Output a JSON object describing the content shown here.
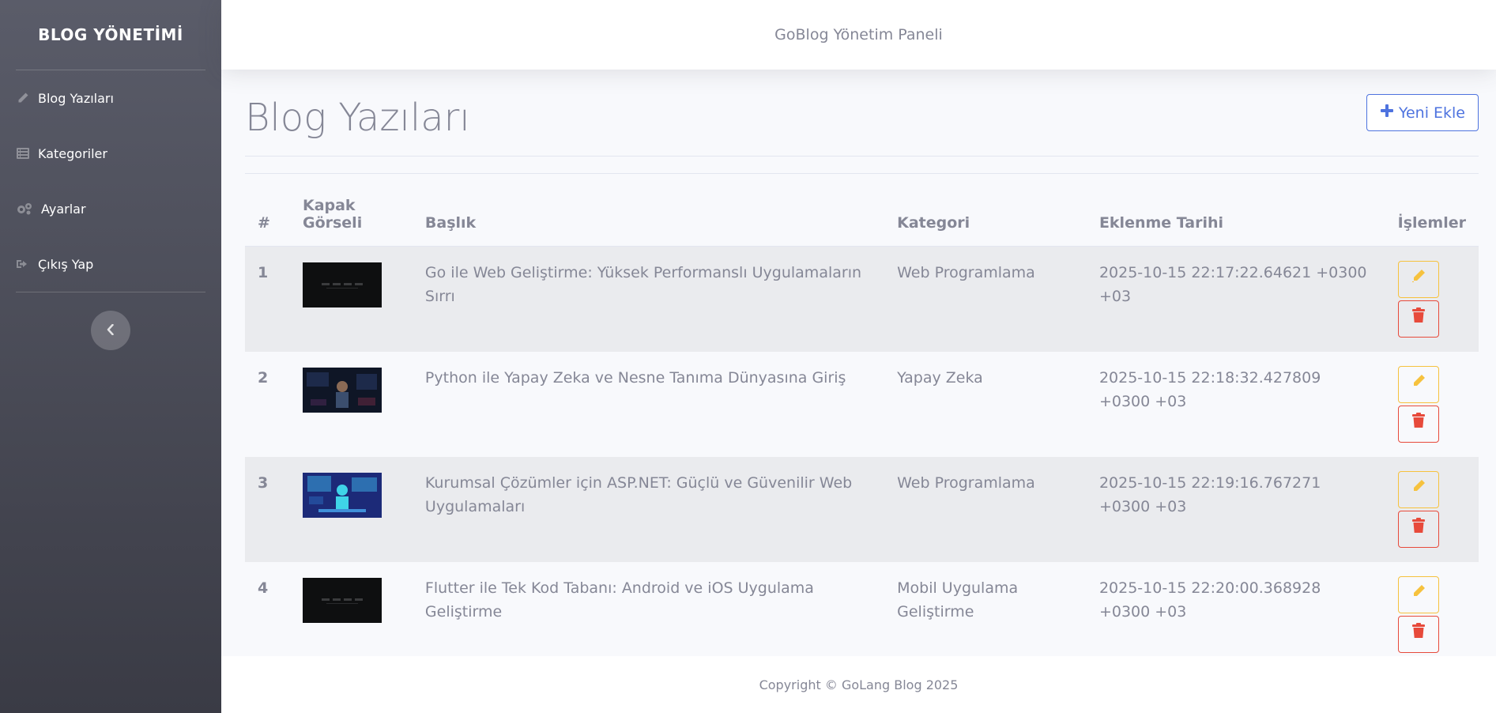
{
  "sidebar": {
    "brand": "BLOG YÖNETİMİ",
    "items": [
      {
        "label": "Blog Yazıları",
        "icon": "pencil-icon"
      },
      {
        "label": "Kategoriler",
        "icon": "list-icon"
      },
      {
        "label": "Ayarlar",
        "icon": "gears-icon"
      },
      {
        "label": "Çıkış Yap",
        "icon": "sign-out-icon"
      }
    ],
    "toggle_icon": "chevron-left-icon"
  },
  "topbar": {
    "title": "GoBlog Yönetim Paneli"
  },
  "main": {
    "title": "Blog Yazıları",
    "add_button": "Yeni Ekle",
    "table": {
      "columns": [
        "#",
        "Kapak Görseli",
        "Başlık",
        "Kategori",
        "Eklenme Tarihi",
        "İşlemler"
      ],
      "rows": [
        {
          "num": "1",
          "title": "Go ile Web Geliştirme: Yüksek Performanslı Uygulamaların Sırrı",
          "category": "Web Programlama",
          "date": "2025-10-15 22:17:22.64621 +0300 +03",
          "thumb": "dark-code"
        },
        {
          "num": "2",
          "title": "Python ile Yapay Zeka ve Nesne Tanıma Dünyasına Giriş",
          "category": "Yapay Zeka",
          "date": "2025-10-15 22:18:32.427809 +0300 +03",
          "thumb": "dark-ai"
        },
        {
          "num": "3",
          "title": "Kurumsal Çözümler için ASP.NET: Güçlü ve Güvenilir Web Uygulamaları",
          "category": "Web Programlama",
          "date": "2025-10-15 22:19:16.767271 +0300 +03",
          "thumb": "blue-dev"
        },
        {
          "num": "4",
          "title": "Flutter ile Tek Kod Tabanı: Android ve iOS Uygulama Geliştirme",
          "category": "Mobil Uygulama Geliştirme",
          "date": "2025-10-15 22:20:00.368928 +0300 +03",
          "thumb": "dark-code"
        }
      ]
    }
  },
  "footer": {
    "text": "Copyright © GoLang Blog 2025"
  },
  "colors": {
    "primary": "#4e73df",
    "warning": "#f6c23e",
    "danger": "#e74a3b",
    "text": "#858796"
  }
}
